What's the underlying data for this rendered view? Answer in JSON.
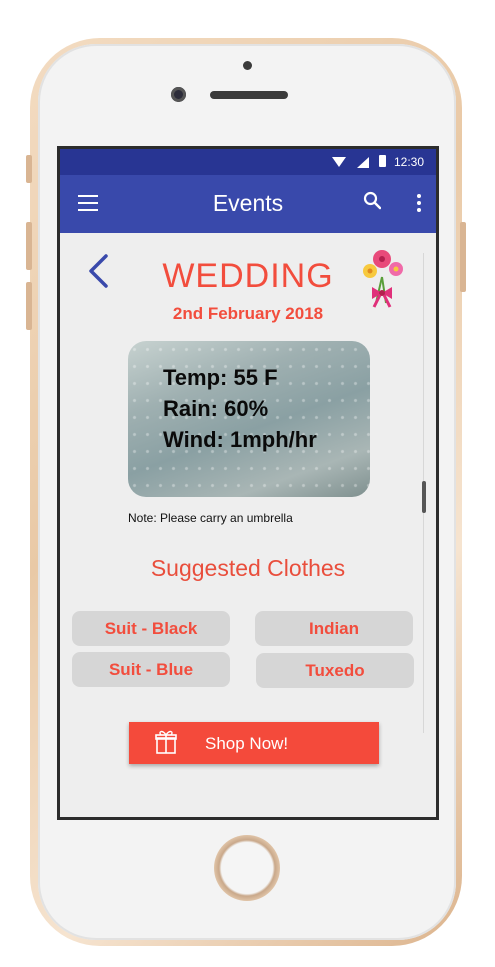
{
  "status_bar": {
    "time": "12:30"
  },
  "app_bar": {
    "title": "Events"
  },
  "event": {
    "name": "WEDDING",
    "date": "2nd February 2018"
  },
  "weather": {
    "temp": "Temp: 55 F",
    "rain": "Rain: 60%",
    "wind": "Wind: 1mph/hr"
  },
  "note": "Note: Please carry an umbrella",
  "suggested": {
    "heading": "Suggested Clothes",
    "items": [
      "Suit - Black",
      "Indian",
      "Suit - Blue",
      "Tuxedo"
    ]
  },
  "shop_button": {
    "label": "Shop Now!"
  },
  "icons": [
    "menu-icon",
    "search-icon",
    "more-vert-icon",
    "back-chevron-icon",
    "bouquet-icon",
    "gift-icon",
    "wifi-icon",
    "signal-icon",
    "battery-icon"
  ],
  "colors": {
    "status_bar": "#283593",
    "app_bar": "#3949ab",
    "accent": "#f24d3d",
    "chip_bg": "#d6d6d6",
    "background": "#eeeeee"
  }
}
